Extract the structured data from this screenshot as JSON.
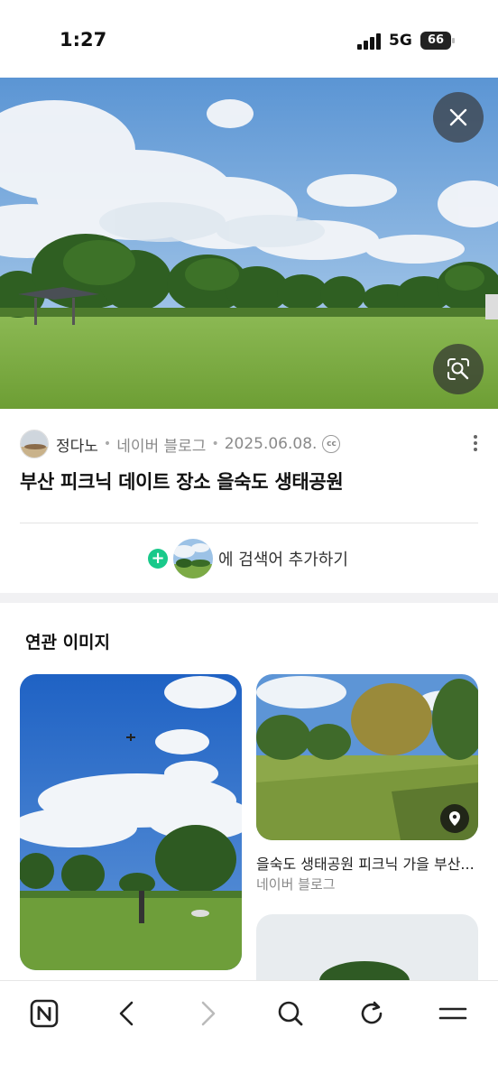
{
  "status_bar": {
    "time": "1:27",
    "network": "5G",
    "battery": "66"
  },
  "source": {
    "author": "정다노",
    "platform": "네이버 블로그",
    "date": "2025.06.08.",
    "license_badge": "cc"
  },
  "title": "부산 피크닉 데이트 장소 을숙도 생태공원",
  "add_search": {
    "plus": "+",
    "label": "에 검색어 추가하기"
  },
  "related": {
    "heading": "연관 이미지",
    "items": [
      {
        "title": "",
        "source": ""
      },
      {
        "title": "을숙도 생태공원 피크닉 가을 부산...",
        "source": "네이버 블로그"
      },
      {
        "title": "",
        "source": ""
      }
    ]
  },
  "icons": {
    "close": "close-icon",
    "lens": "image-search-icon",
    "more": "more-vertical-icon",
    "pin": "location-pin-icon",
    "nav": [
      "naver-home-icon",
      "back-arrow-icon",
      "forward-arrow-icon",
      "search-icon",
      "refresh-icon",
      "menu-icon"
    ]
  },
  "colors": {
    "accent_green": "#19c98a",
    "sky": "#6fa6dc",
    "grass": "#6fa23a"
  }
}
